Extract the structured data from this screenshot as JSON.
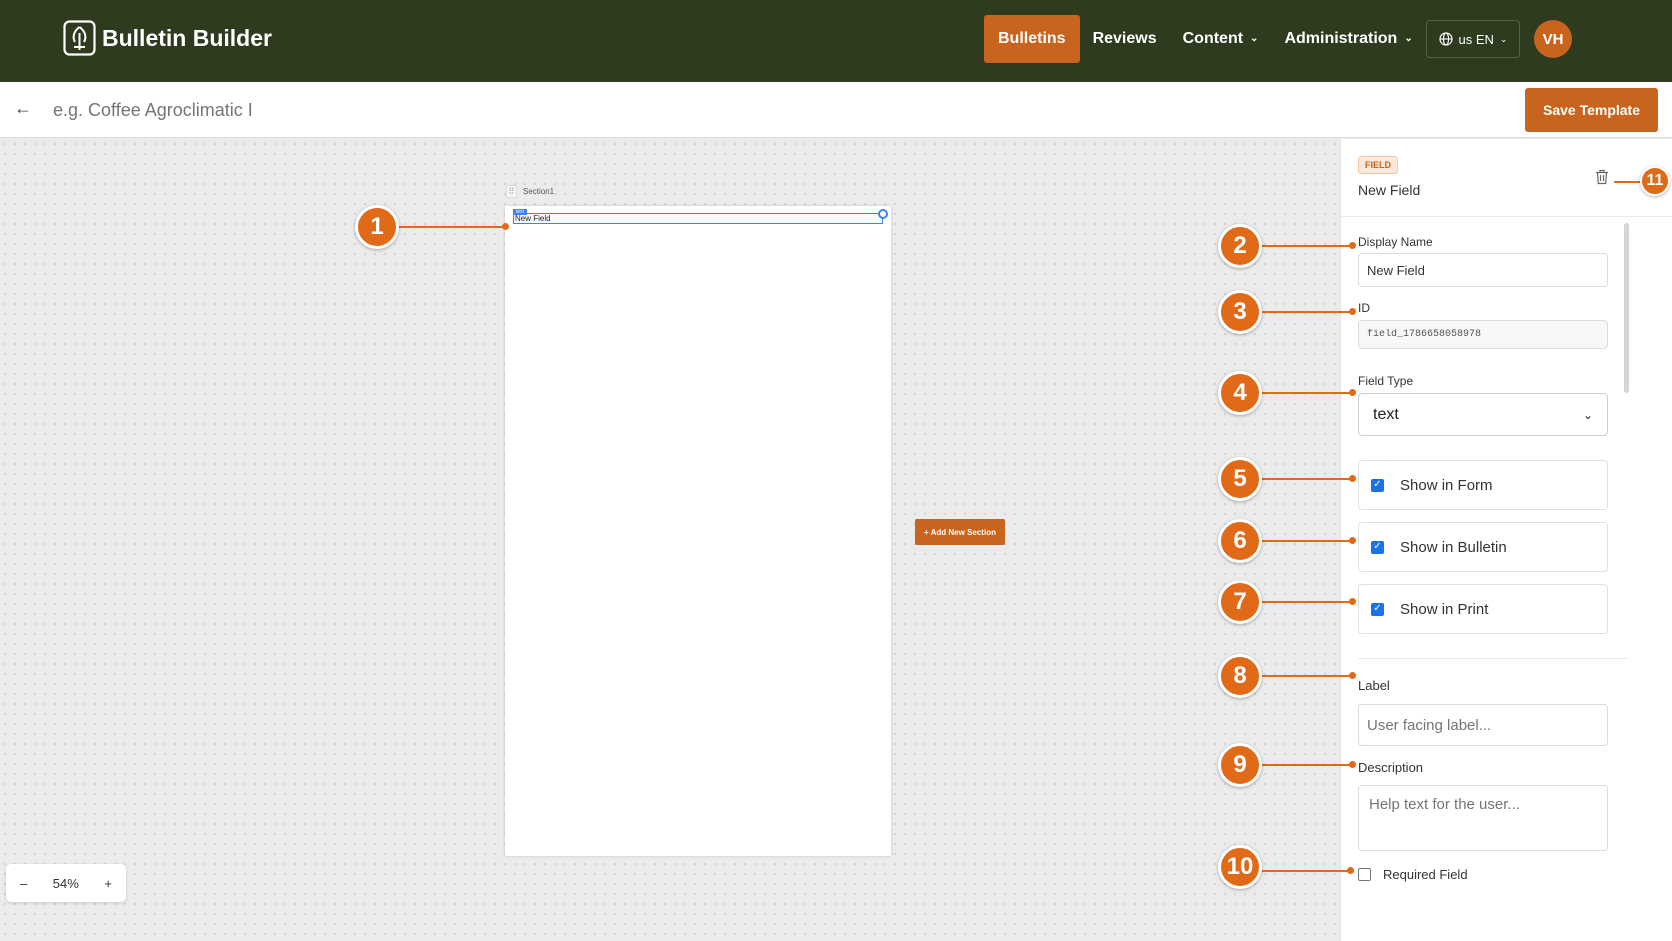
{
  "app": {
    "title": "Bulletin Builder"
  },
  "nav": {
    "items": [
      {
        "label": "Bulletins",
        "active": true
      },
      {
        "label": "Reviews"
      },
      {
        "label": "Content",
        "has_menu": true
      },
      {
        "label": "Administration",
        "has_menu": true
      }
    ],
    "language": "us EN",
    "avatar_initials": "VH"
  },
  "subheader": {
    "template_name_placeholder": "e.g. Coffee Agroclimatic I",
    "save_label": "Save Template"
  },
  "canvas": {
    "section_label": "Section1",
    "section_handle": "⠿",
    "field_badge": "text",
    "field_text": "New Field",
    "add_section_label": "+ Add New Section",
    "zoom": {
      "minus": "–",
      "value": "54%",
      "plus": "+"
    }
  },
  "panel": {
    "type_badge": "FIELD",
    "title": "New Field",
    "display_name_label": "Display Name",
    "display_name_value": "New Field",
    "id_label": "ID",
    "id_value": "field_1786658058978",
    "field_type_label": "Field Type",
    "field_type_value": "text",
    "checks": [
      {
        "label": "Show in Form",
        "checked": true
      },
      {
        "label": "Show in Bulletin",
        "checked": true
      },
      {
        "label": "Show in Print",
        "checked": true
      }
    ],
    "label_label": "Label",
    "label_placeholder": "User facing label...",
    "description_label": "Description",
    "description_placeholder": "Help text for the user...",
    "required_label": "Required Field",
    "required_checked": false
  },
  "annotations": [
    "1",
    "2",
    "3",
    "4",
    "5",
    "6",
    "7",
    "8",
    "9",
    "10",
    "11"
  ],
  "colors": {
    "navbar": "#2e3b1f",
    "accent": "#c8641d",
    "callout": "#e06a17",
    "selection": "#3b82f6"
  }
}
